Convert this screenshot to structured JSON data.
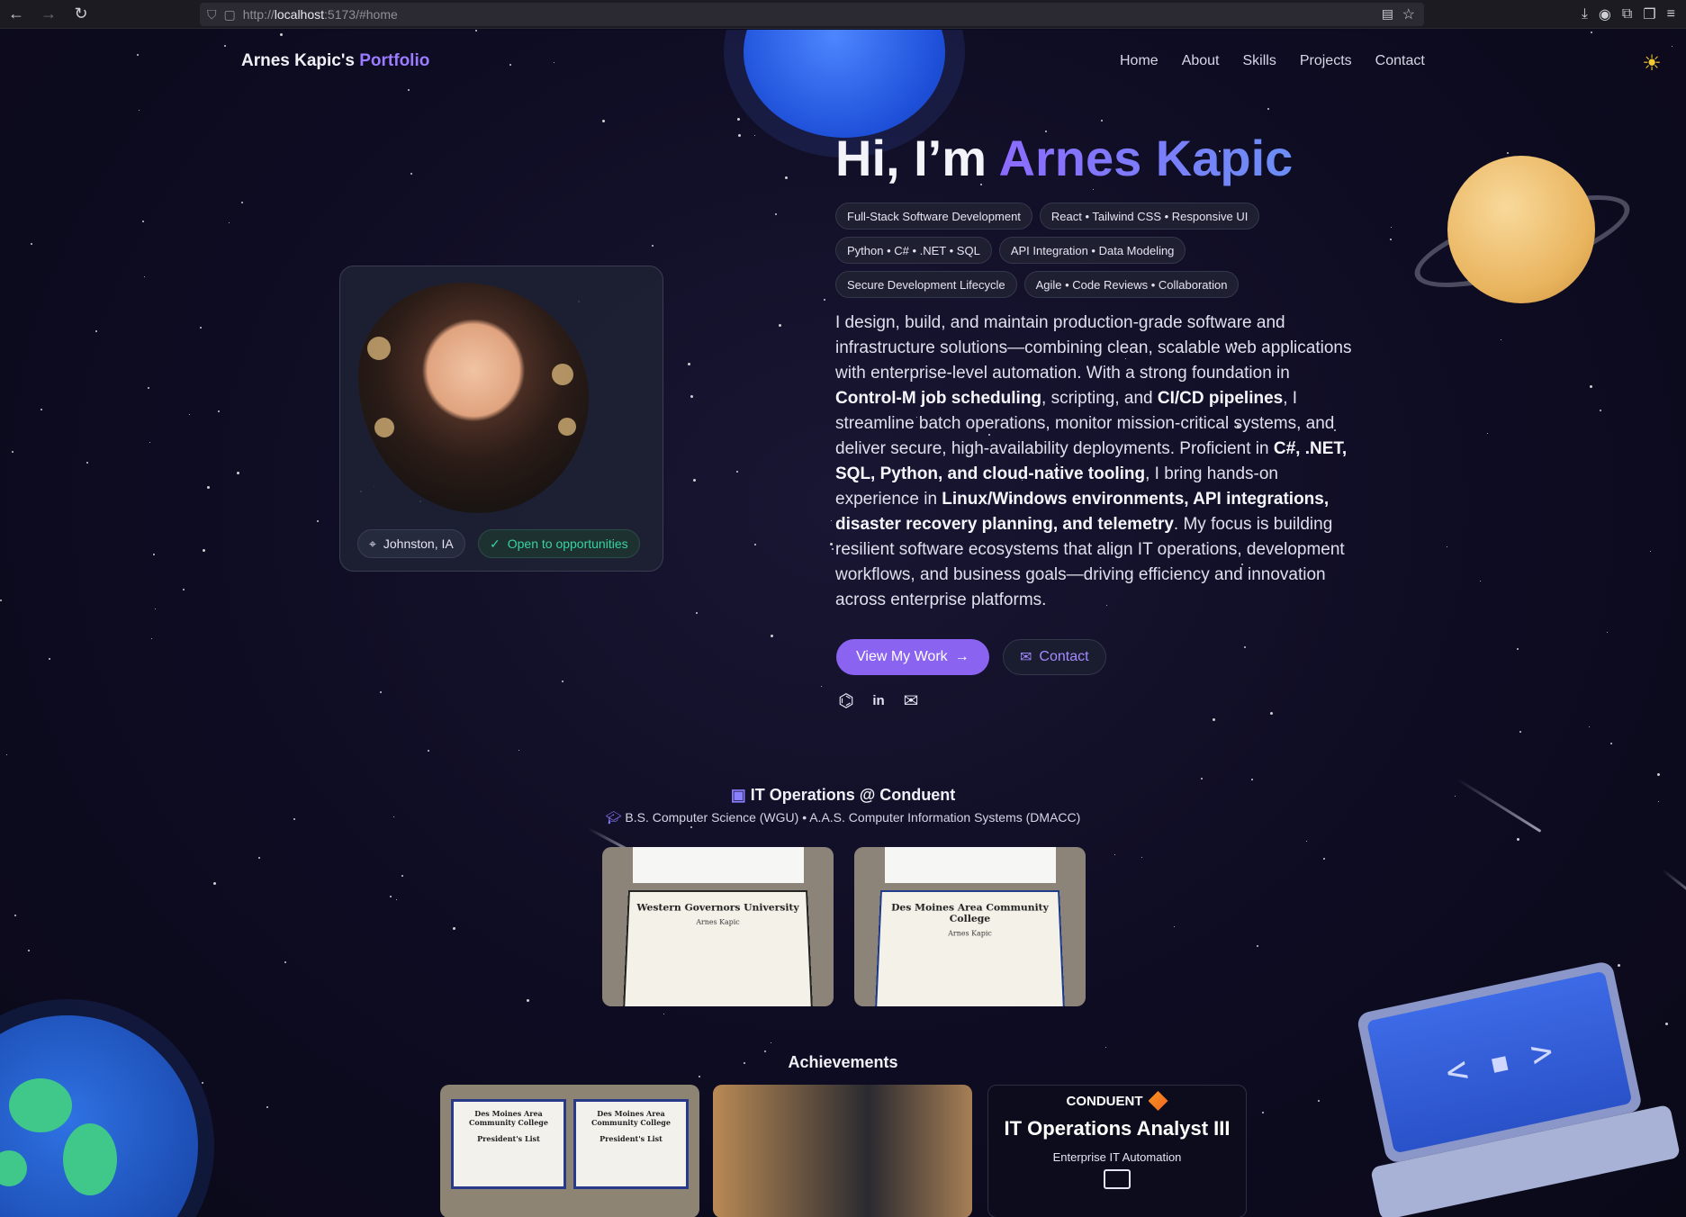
{
  "browser": {
    "url_prefix": "http://",
    "url_host": "localhost",
    "url_rest": ":5173/#home"
  },
  "header": {
    "brand_name": "Arnes Kapic's",
    "brand_accent": "Portfolio",
    "nav": [
      "Home",
      "About",
      "Skills",
      "Projects",
      "Contact"
    ]
  },
  "profile": {
    "location": "Johnston, IA",
    "status": "Open to opportunities"
  },
  "hero": {
    "greeting": "Hi, I’m",
    "name": "Arnes Kapic",
    "tags": [
      "Full-Stack Software Development",
      "React • Tailwind CSS • Responsive UI",
      "Python • C# • .NET • SQL",
      "API Integration • Data Modeling",
      "Secure Development Lifecycle",
      "Agile • Code Reviews • Collaboration"
    ],
    "bio": {
      "p1": "I design, build, and maintain production-grade software and infrastructure solutions—combining clean, scalable web applications with enterprise-level automation. With a strong foundation in ",
      "b1": "Control-M job scheduling",
      "p2": ", scripting, and ",
      "b2": "CI/CD pipelines",
      "p3": ", I streamline batch operations, monitor mission-critical systems, and deliver secure, high-availability deployments. Proficient in ",
      "b3": "C#, .NET, SQL, Python, and cloud-native tooling",
      "p4": ", I bring hands-on experience in ",
      "b4": "Linux/Windows environments, API integrations, disaster recovery planning, and telemetry",
      "p5": ". My focus is building resilient software ecosystems that align IT operations, development workflows, and business goals—driving efficiency and innovation across enterprise platforms."
    },
    "primary_button": "View My Work",
    "secondary_button": "Contact"
  },
  "education": {
    "title": "IT Operations @ Conduent",
    "subtitle": "B.S. Computer Science (WGU) • A.A.S. Computer Information Systems (DMACC)",
    "diplomas": [
      {
        "school": "Western Governors University",
        "name": "Arnes Kapic"
      },
      {
        "school": "Des Moines Area Community College",
        "name": "Arnes Kapic"
      }
    ]
  },
  "achievements": {
    "title": "Achievements",
    "certs": [
      {
        "school": "Des Moines Area Community College",
        "label": "President's List"
      },
      {
        "school": "Des Moines Area Community College",
        "label": "President's List"
      }
    ],
    "conduent": {
      "brand": "CONDUENT",
      "role": "IT Operations Analyst III",
      "desc": "Enterprise IT Automation"
    }
  },
  "colors": {
    "accent": "#8a64f0",
    "status_green": "#38d39f",
    "sun_icon": "#f2c935"
  }
}
